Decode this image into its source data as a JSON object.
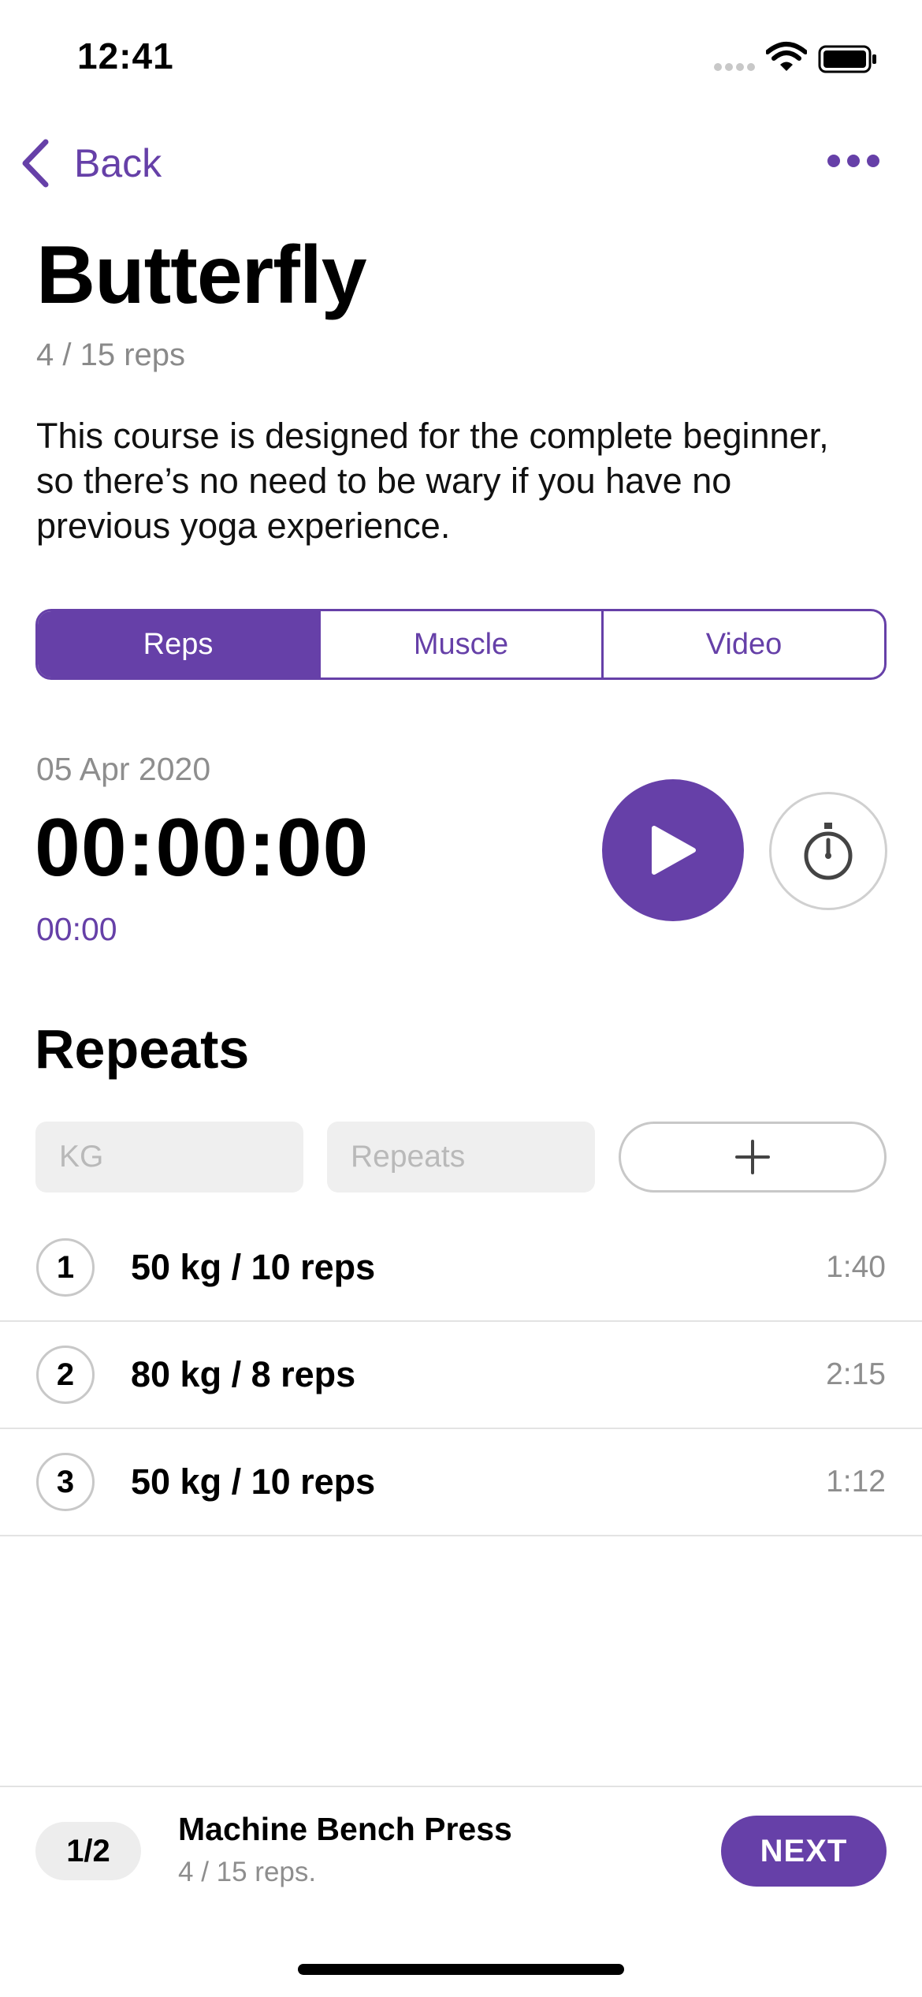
{
  "status_bar": {
    "time": "12:41"
  },
  "nav": {
    "back_label": "Back"
  },
  "exercise": {
    "title": "Butterfly",
    "progress": "4 / 15 reps",
    "description": "This course is designed for the complete beginner, so there’s no need to be wary if you have no previous yoga experience."
  },
  "tabs": [
    {
      "label": "Reps",
      "active": true
    },
    {
      "label": "Muscle",
      "active": false
    },
    {
      "label": "Video",
      "active": false
    }
  ],
  "timer": {
    "date": "05 Apr 2020",
    "elapsed": "00:00:00",
    "sub": "00:00"
  },
  "repeats": {
    "title": "Repeats",
    "kg_placeholder": "KG",
    "repeats_placeholder": "Repeats",
    "items": [
      {
        "index": "1",
        "label": "50 kg / 10 reps",
        "time": "1:40"
      },
      {
        "index": "2",
        "label": "80 kg / 8 reps",
        "time": "2:15"
      },
      {
        "index": "3",
        "label": "50 kg / 10 reps",
        "time": "1:12"
      }
    ]
  },
  "footer": {
    "pager": "1/2",
    "next_title": "Machine Bench Press",
    "next_sub": "4 / 15 reps.",
    "next_button": "NEXT"
  },
  "icons": {
    "back": "chevron-left-icon",
    "more": "more-horizontal-icon",
    "play": "play-icon",
    "stopwatch": "stopwatch-icon",
    "add": "plus-icon"
  },
  "colors": {
    "accent": "#6640a8",
    "muted": "#8e8e8e",
    "border": "#c8c8c8"
  }
}
